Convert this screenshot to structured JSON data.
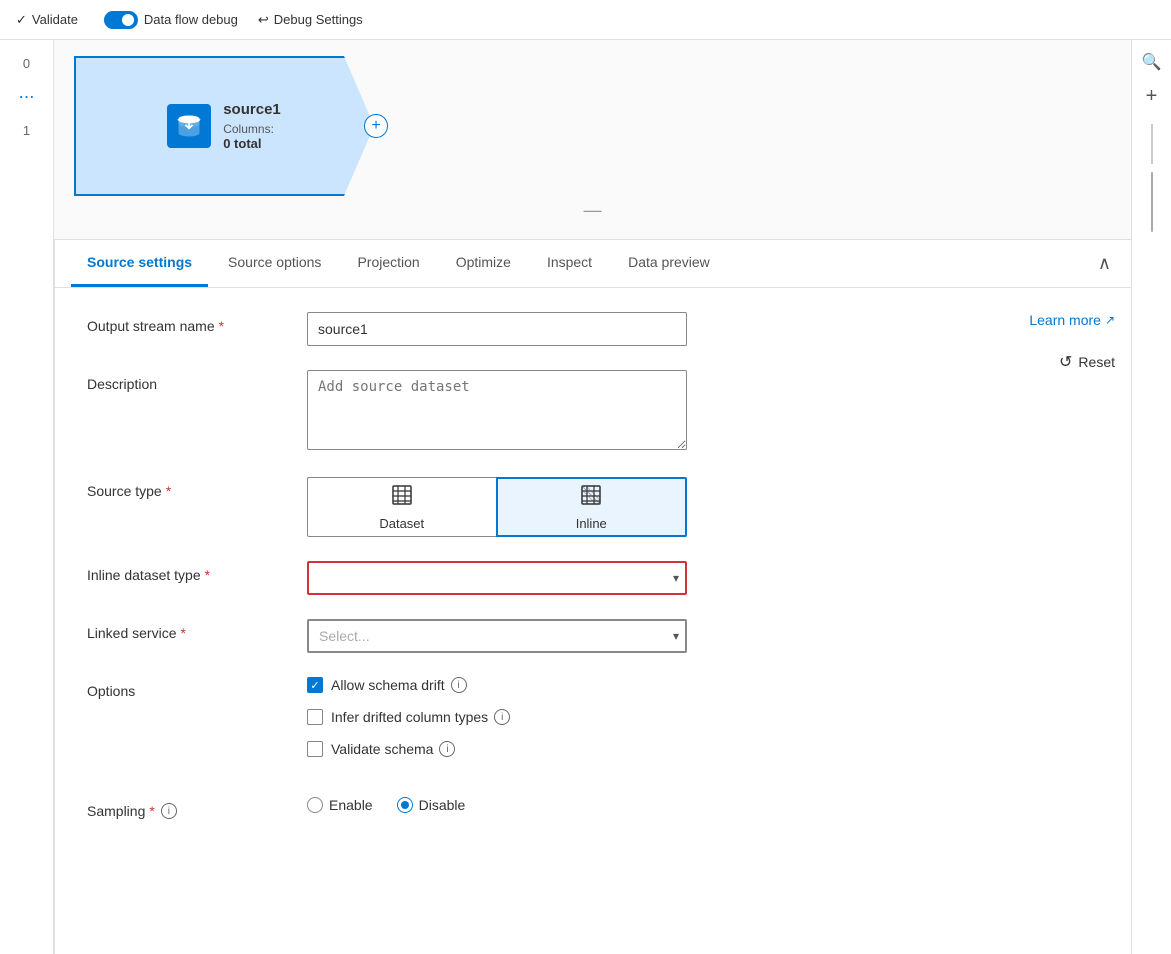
{
  "topbar": {
    "validate_label": "Validate",
    "dataflow_debug_label": "Data flow debug",
    "debug_settings_label": "Debug Settings"
  },
  "node": {
    "title": "source1",
    "columns_label": "Columns:",
    "columns_count": "0 total"
  },
  "tabs": [
    {
      "id": "source-settings",
      "label": "Source settings",
      "active": true
    },
    {
      "id": "source-options",
      "label": "Source options",
      "active": false
    },
    {
      "id": "projection",
      "label": "Projection",
      "active": false
    },
    {
      "id": "optimize",
      "label": "Optimize",
      "active": false
    },
    {
      "id": "inspect",
      "label": "Inspect",
      "active": false
    },
    {
      "id": "data-preview",
      "label": "Data preview",
      "active": false
    }
  ],
  "form": {
    "output_stream_name_label": "Output stream name",
    "output_stream_name_value": "source1",
    "description_label": "Description",
    "description_placeholder": "Add source dataset",
    "source_type_label": "Source type",
    "source_type_dataset_label": "Dataset",
    "source_type_inline_label": "Inline",
    "inline_dataset_type_label": "Inline dataset type",
    "linked_service_label": "Linked service",
    "linked_service_placeholder": "Select...",
    "options_label": "Options",
    "allow_schema_drift_label": "Allow schema drift",
    "infer_drifted_label": "Infer drifted column types",
    "validate_schema_label": "Validate schema",
    "sampling_label": "Sampling",
    "enable_label": "Enable",
    "disable_label": "Disable",
    "learn_more_label": "Learn more",
    "reset_label": "Reset",
    "add_btn": "+"
  },
  "sidebar_left": {
    "num1": "0",
    "num2": "1"
  }
}
